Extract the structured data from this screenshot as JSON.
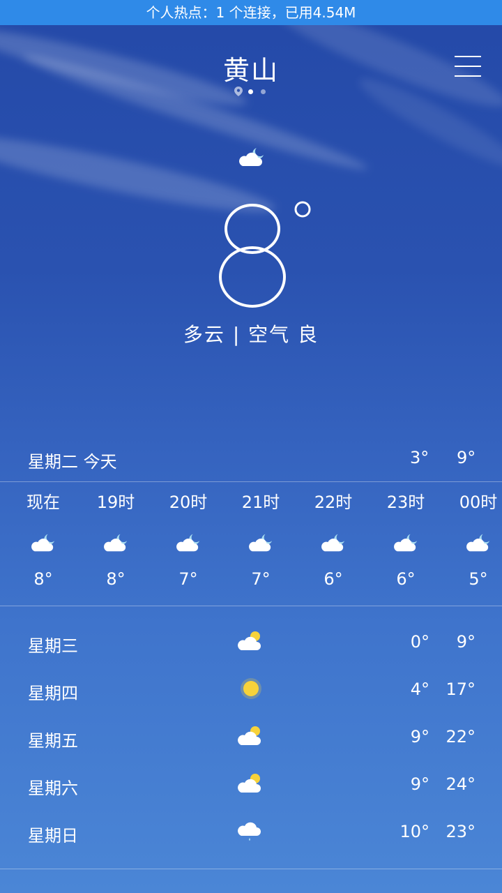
{
  "status_bar": {
    "text": "个人热点：1 个连接，已用4.54M"
  },
  "header": {
    "city": "黄山",
    "menu_icon": "menu-icon"
  },
  "current": {
    "icon": "partly-cloudy-night-icon",
    "temperature": "8",
    "degree_symbol": "°",
    "condition": "多云 | 空气 良"
  },
  "today": {
    "day": "星期二  今天",
    "low": "3°",
    "high": "9°"
  },
  "hourly": [
    {
      "time": "现在",
      "icon": "partly-cloudy-night-icon",
      "temp": "8°"
    },
    {
      "time": "19时",
      "icon": "partly-cloudy-night-icon",
      "temp": "8°"
    },
    {
      "time": "20时",
      "icon": "partly-cloudy-night-icon",
      "temp": "7°"
    },
    {
      "time": "21时",
      "icon": "partly-cloudy-night-icon",
      "temp": "7°"
    },
    {
      "time": "22时",
      "icon": "partly-cloudy-night-icon",
      "temp": "6°"
    },
    {
      "time": "23时",
      "icon": "partly-cloudy-night-icon",
      "temp": "6°"
    },
    {
      "time": "00时",
      "icon": "partly-cloudy-night-icon",
      "temp": "5°"
    }
  ],
  "daily": [
    {
      "day": "星期三",
      "icon": "partly-cloudy-day-icon",
      "low": "0°",
      "high": "9°"
    },
    {
      "day": "星期四",
      "icon": "sunny-icon",
      "low": "4°",
      "high": "17°"
    },
    {
      "day": "星期五",
      "icon": "partly-cloudy-day-icon",
      "low": "9°",
      "high": "22°"
    },
    {
      "day": "星期六",
      "icon": "partly-cloudy-day-icon",
      "low": "9°",
      "high": "24°"
    },
    {
      "day": "星期日",
      "icon": "rain-icon",
      "low": "10°",
      "high": "23°"
    }
  ],
  "colors": {
    "status_bar": "#2f8ae8",
    "sky_top": "#2449a8",
    "sky_bottom": "#4b86d6",
    "moon": "#a8dcf0",
    "sun": "#f7d23a"
  }
}
